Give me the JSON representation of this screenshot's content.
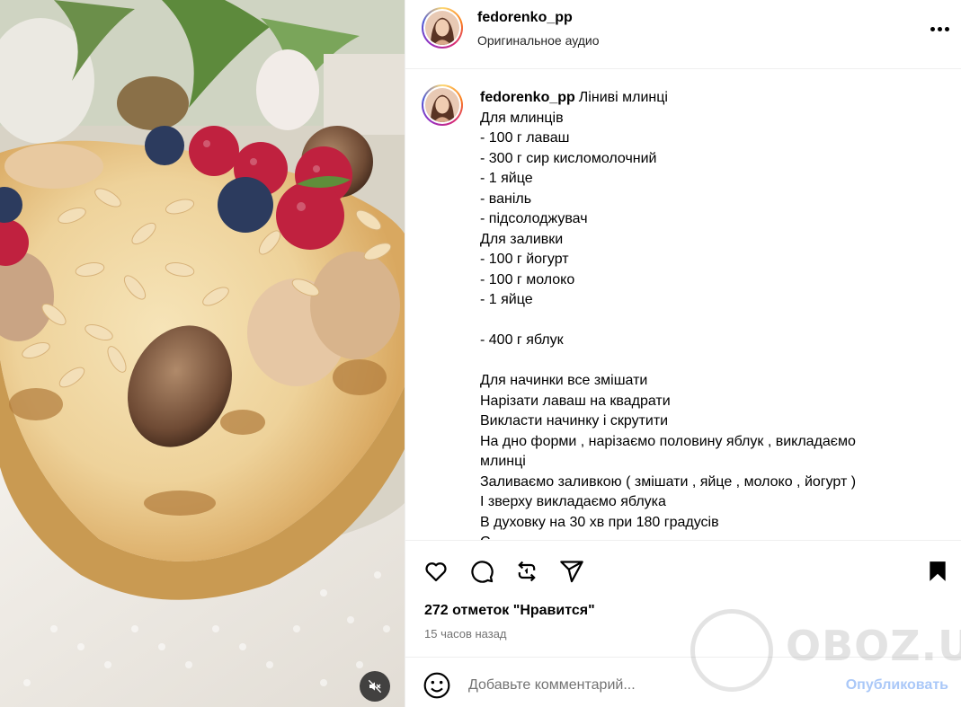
{
  "post": {
    "username": "fedorenko_pp",
    "audio_label": "Оригинальное аудио",
    "caption_title": "Ліниві млинці",
    "caption_lines": [
      "Для млинців",
      "- 100 г лаваш",
      "- 300 г сир кисломолочний",
      "- 1 яйце",
      "- ваніль",
      "- підсолоджувач",
      "Для заливки",
      "- 100 г йогурт",
      "- 100 г молоко",
      "- 1 яйце",
      "",
      "- 400 г яблук",
      "",
      "Для начинки все змішати",
      "Нарізати лаваш на квадрати",
      "Викласти начинку і скрутити",
      "На дно форми , нарізаємо половину яблук , викладаємо млинці",
      "Заливаємо заливкою ( змішати , яйце , молоко , йогурт )",
      "І зверху викладаємо яблука",
      "В духовку на 30 хв при 180 градусів",
      "С"
    ],
    "likes_text": "272 отметок \"Нравится\"",
    "time_text": "15 часов назад"
  },
  "comment": {
    "placeholder": "Добавьте комментарий...",
    "post_label": "Опубликовать"
  },
  "icons": {
    "like": "heart-icon",
    "comment": "comment-icon",
    "repost": "repost-icon",
    "share": "send-icon",
    "save": "bookmark-icon",
    "emoji": "smiley-icon",
    "more": "more-icon",
    "mute": "muted-speaker-icon"
  },
  "watermark": {
    "text": "OBOZ.UA"
  },
  "colors": {
    "post_button": "#aac8f8",
    "muted_text": "#737373",
    "divider": "#efefef"
  }
}
